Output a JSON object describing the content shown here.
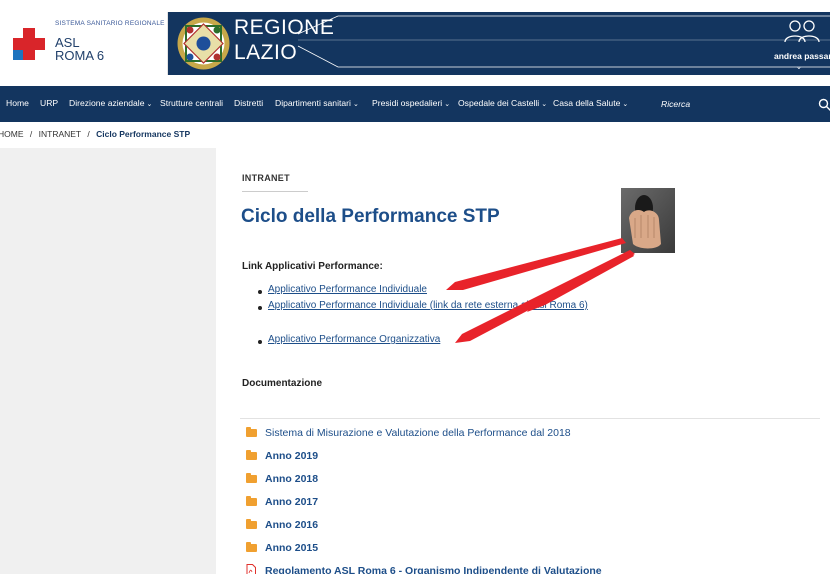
{
  "header": {
    "asl_subtitle": "SISTEMA SANITARIO REGIONALE",
    "asl_line1": "ASL",
    "asl_line2": "ROMA 6",
    "regione_line1": "REGIONE",
    "regione_line2": "LAZIO",
    "user_name": "andrea passaret",
    "user_caret": "⌄"
  },
  "nav": {
    "items": [
      {
        "label": "Home"
      },
      {
        "label": "URP"
      },
      {
        "label": "Direzione aziendale"
      },
      {
        "label": "Strutture centrali"
      },
      {
        "label": "Distretti"
      },
      {
        "label": "Dipartimenti sanitari"
      },
      {
        "label": "Presidi ospedalieri"
      },
      {
        "label": "Ospedale dei Castelli"
      },
      {
        "label": "Casa della Salute"
      }
    ],
    "chevron": "⌄",
    "search_placeholder": "Ricerca"
  },
  "breadcrumb": {
    "home": "HOME",
    "intranet": "INTRANET",
    "current": "Ciclo Performance STP",
    "separator": "/"
  },
  "main": {
    "kicker": "INTRANET",
    "title": "Ciclo della Performance STP",
    "links_heading": "Link Applicativi Performance:",
    "links": [
      "Applicativo Performance Individuale",
      "Applicativo Performance Individuale (link da rete esterna all'Asl Roma 6)",
      "Applicativo Performance Organizzativa"
    ],
    "doc_heading": "Documentazione",
    "folders": [
      "Sistema di Misurazione e Valutazione della Performance dal 2018",
      "Anno 2019",
      "Anno 2018",
      "Anno 2017",
      "Anno 2016",
      "Anno 2015"
    ],
    "pdf_item": "Regolamento ASL Roma 6 - Organismo Indipendente di Valutazione"
  },
  "colors": {
    "navy": "#13355f",
    "link": "#1d4e89",
    "folder": "#f0a030",
    "annotation_arrow": "#e8232a",
    "sidebar": "#f0f0f0"
  }
}
